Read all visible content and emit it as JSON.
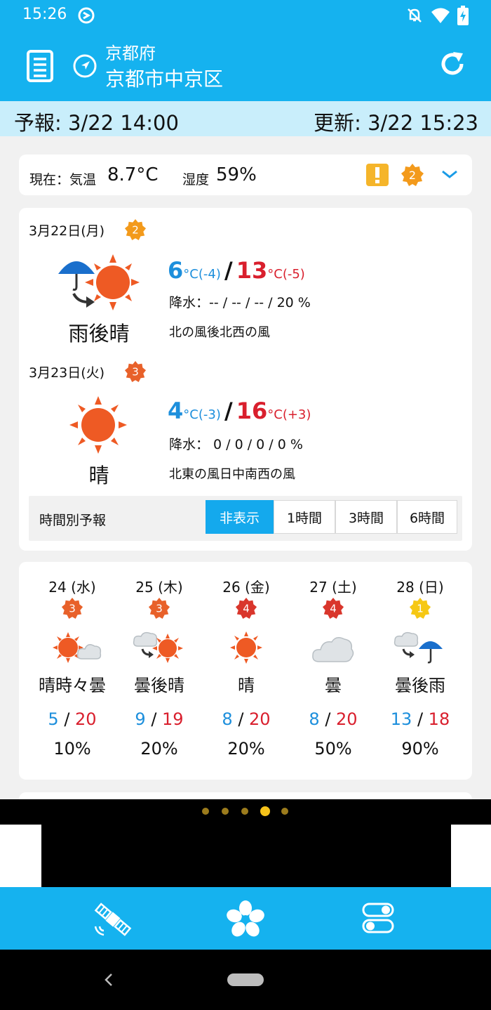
{
  "status_bar": {
    "time": "15:26"
  },
  "header": {
    "prefecture": "京都府",
    "city": "京都市中京区"
  },
  "date_bar": {
    "forecast": "予報: 3/22 14:00",
    "updated": "更新: 3/22 15:23"
  },
  "current": {
    "temp_label": "現在：気温",
    "temp": "8.7°C",
    "humidity_label": "湿度",
    "humidity": "59%",
    "alert_badge": "2"
  },
  "days": [
    {
      "date": "3月22日(月)",
      "badge": "2",
      "weather": "雨後晴",
      "low": "6",
      "low_diff": "(-4)",
      "high": "13",
      "high_diff": "(-5)",
      "precip": "降水：-- / -- / -- / 20 %",
      "wind": "北の風後北西の風",
      "unit": "°C"
    },
    {
      "date": "3月23日(火)",
      "badge": "3",
      "weather": "晴",
      "low": "4",
      "low_diff": "(-3)",
      "high": "16",
      "high_diff": "(+3)",
      "precip": "降水： 0 / 0 / 0 / 0 %",
      "wind": "北東の風日中南西の風",
      "unit": "°C"
    }
  ],
  "hourly": {
    "label": "時間別予報",
    "options": [
      "非表示",
      "1時間",
      "3時間",
      "6時間"
    ],
    "selected": "非表示"
  },
  "week": [
    {
      "day": "24 (水)",
      "badge": "3",
      "weather": "晴時々曇",
      "low": "5",
      "high": "20",
      "pop": "10%"
    },
    {
      "day": "25 (木)",
      "badge": "3",
      "weather": "曇後晴",
      "low": "9",
      "high": "19",
      "pop": "20%"
    },
    {
      "day": "26 (金)",
      "badge": "4",
      "weather": "晴",
      "low": "8",
      "high": "20",
      "pop": "20%"
    },
    {
      "day": "27 (土)",
      "badge": "4",
      "weather": "曇",
      "low": "8",
      "high": "20",
      "pop": "50%"
    },
    {
      "day": "28 (日)",
      "badge": "1",
      "weather": "曇後雨",
      "low": "13",
      "high": "18",
      "pop": "90%"
    }
  ],
  "colors": {
    "accent": "#15b2ef",
    "low_temp": "#1d8fdc",
    "high_temp": "#d91f2d",
    "badge_orange": "#f39a1b",
    "badge_dark_orange": "#e8612a",
    "badge_red": "#d9362c",
    "badge_yellow": "#f6c814"
  },
  "icons": {
    "header": [
      "menu-list-icon",
      "location-arrow-icon",
      "refresh-icon"
    ],
    "alert": "warning-icon",
    "bottom_nav": [
      "satellite-icon",
      "flower-icon",
      "toggle-settings-icon"
    ]
  }
}
